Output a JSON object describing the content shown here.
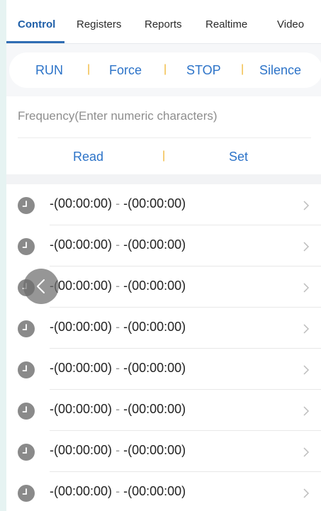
{
  "tabs": [
    {
      "label": "Control",
      "active": true
    },
    {
      "label": "Registers",
      "active": false
    },
    {
      "label": "Reports",
      "active": false
    },
    {
      "label": "Realtime",
      "active": false
    },
    {
      "label": "Video",
      "active": false
    }
  ],
  "actions": {
    "run": "RUN",
    "force": "Force",
    "stop": "STOP",
    "silence": "Silence",
    "separator": "|"
  },
  "frequency": {
    "placeholder": "Frequency(Enter numeric characters)",
    "value": "",
    "read_label": "Read",
    "set_label": "Set",
    "separator": "|"
  },
  "schedule": [
    {
      "start": "-(00:00:00)",
      "sep": "-",
      "end": "-(00:00:00)"
    },
    {
      "start": "-(00:00:00)",
      "sep": "-",
      "end": "-(00:00:00)"
    },
    {
      "start": "-(00:00:00)",
      "sep": "-",
      "end": "-(00:00:00)"
    },
    {
      "start": "-(00:00:00)",
      "sep": "-",
      "end": "-(00:00:00)"
    },
    {
      "start": "-(00:00:00)",
      "sep": "-",
      "end": "-(00:00:00)"
    },
    {
      "start": "-(00:00:00)",
      "sep": "-",
      "end": "-(00:00:00)"
    },
    {
      "start": "-(00:00:00)",
      "sep": "-",
      "end": "-(00:00:00)"
    },
    {
      "start": "-(00:00:00)",
      "sep": "-",
      "end": "-(00:00:00)"
    }
  ],
  "icons": {
    "row_leading": "clock-icon",
    "row_trailing": "chevron-right-icon",
    "floating": "chevron-left-icon"
  },
  "colors": {
    "accent": "#2c73c8",
    "tab_active": "#1f5fa8",
    "separator": "#f0b530",
    "clock": "#8a8a8a"
  }
}
